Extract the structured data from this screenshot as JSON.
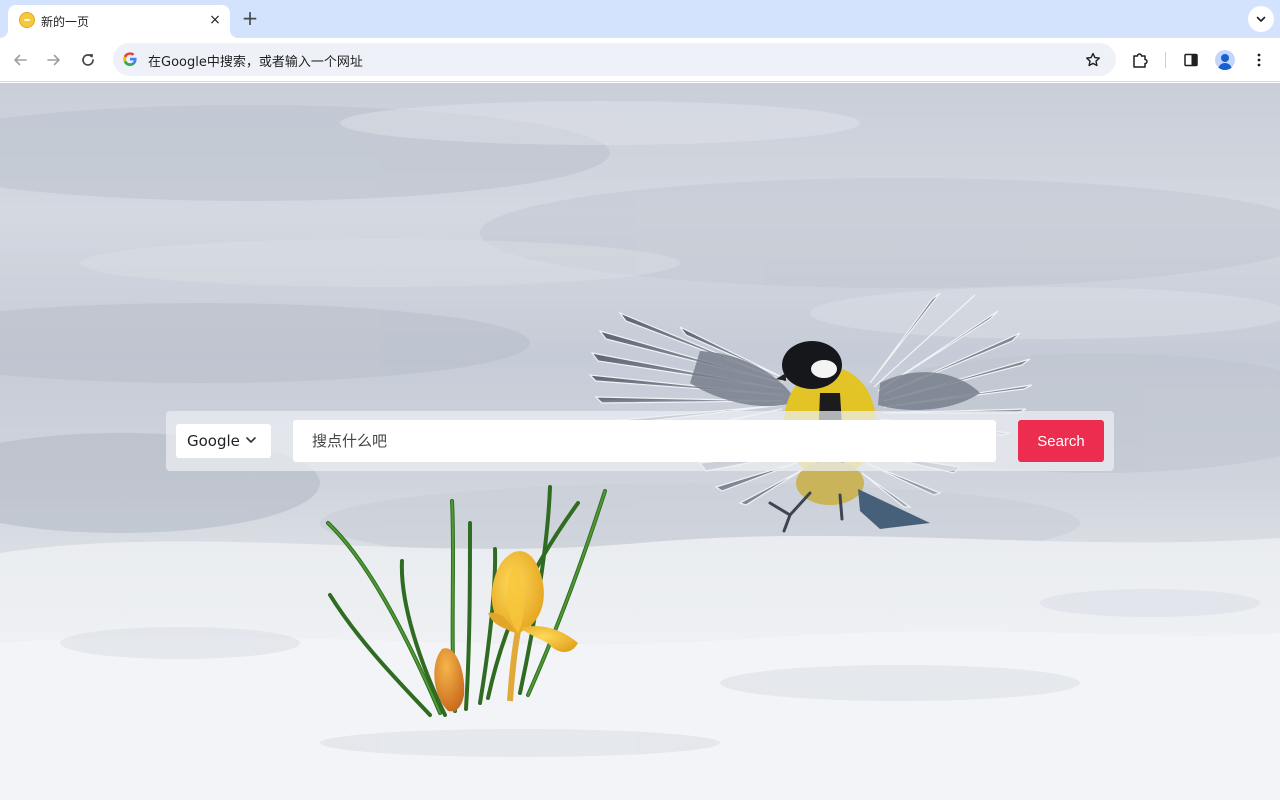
{
  "browser": {
    "tab": {
      "title": "新的一页",
      "close_glyph": "×"
    },
    "new_tab_glyph": "+",
    "omnibox": {
      "placeholder": "在Google中搜索，或者输入一个网址"
    }
  },
  "search": {
    "engine": "Google",
    "placeholder": "搜点什么吧",
    "button_label": "Search"
  },
  "colors": {
    "tabstrip": "#d3e3fd",
    "search_button": "#ec2d4f"
  },
  "icons": [
    "back-arrow-icon",
    "forward-arrow-icon",
    "reload-icon",
    "google-g-icon",
    "star-icon",
    "extensions-icon",
    "side-panel-icon",
    "profile-icon",
    "more-icon",
    "chevron-down-icon"
  ]
}
